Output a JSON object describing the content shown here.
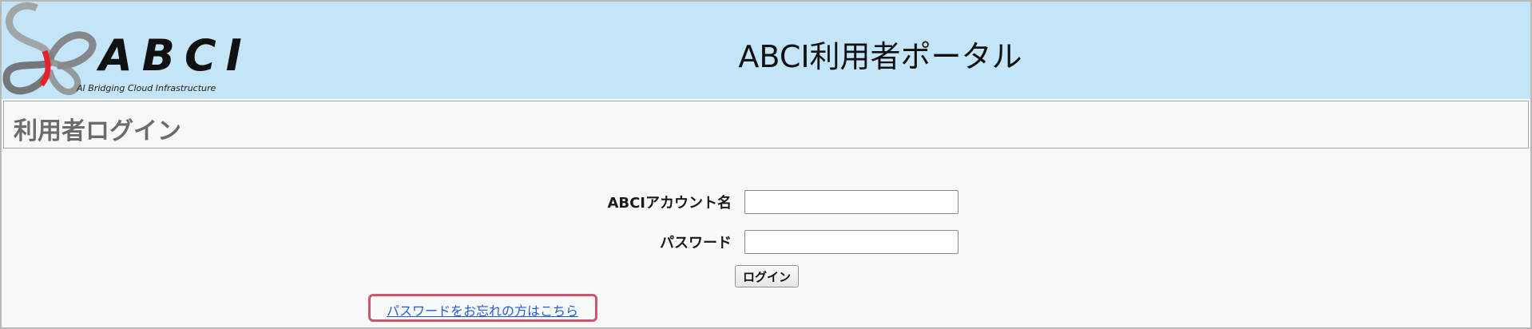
{
  "header": {
    "logo_text": "ABCI",
    "logo_tagline": "AI Bridging Cloud Infrastructure",
    "portal_title": "ABCI利用者ポータル"
  },
  "section": {
    "title": "利用者ログイン"
  },
  "form": {
    "account_label": "ABCIアカウント名",
    "account_value": "",
    "password_label": "パスワード",
    "password_value": "",
    "login_button": "ログイン",
    "forgot_link": "パスワードをお忘れの方はこちら"
  },
  "colors": {
    "header_bg": "#c4e4f8",
    "page_bg": "#f8f8f8",
    "link": "#1f5fd6",
    "highlight_border": "#d0546e",
    "logo_accent": "#e8202a"
  },
  "icons": {
    "logo_mark": "butterfly-logo-icon"
  }
}
